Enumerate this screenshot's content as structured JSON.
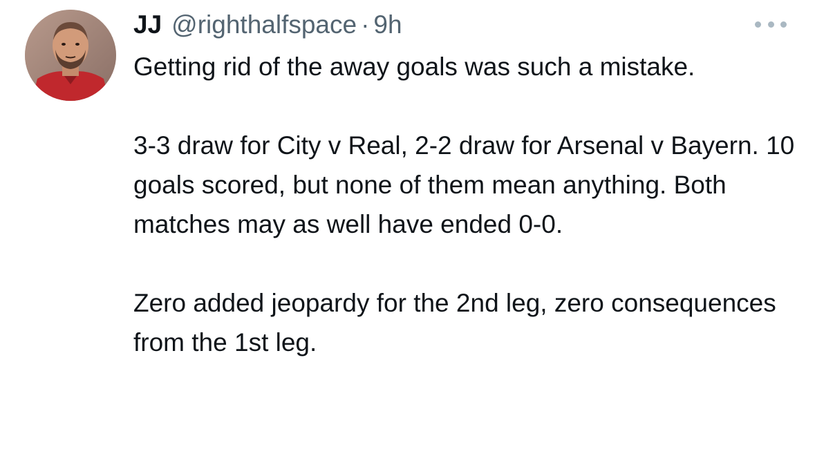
{
  "tweet": {
    "display_name": "JJ",
    "handle": "@righthalfspace",
    "separator": "·",
    "time": "9h",
    "avatar_icon": "profile-photo",
    "more_icon": "more-horizontal-icon",
    "paragraphs": [
      "Getting rid of the away goals was such a mistake.",
      "3-3 draw for City v Real, 2-2 draw for Arsenal v Bayern. 10 goals scored, but none of them mean anything. Both matches may as well have ended 0-0.",
      "Zero added jeopardy for the 2nd leg, zero consequences from the 1st leg."
    ]
  }
}
